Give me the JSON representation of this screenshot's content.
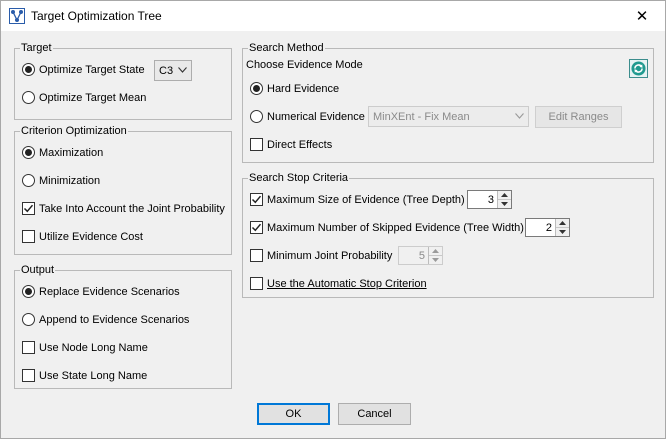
{
  "window": {
    "title": "Target Optimization Tree",
    "close_glyph": "✕"
  },
  "target": {
    "legend": "Target",
    "optimize_state_label": "Optimize Target State",
    "state_value": "C3",
    "optimize_mean_label": "Optimize Target Mean"
  },
  "criterion": {
    "legend": "Criterion Optimization",
    "maximization": "Maximization",
    "minimization": "Minimization",
    "joint_probability": "Take Into Account the Joint Probability",
    "evidence_cost": "Utilize Evidence Cost"
  },
  "output": {
    "legend": "Output",
    "replace": "Replace Evidence Scenarios",
    "append": "Append to Evidence Scenarios",
    "node_long_name": "Use Node Long Name",
    "state_long_name": "Use State Long Name"
  },
  "search_method": {
    "legend": "Search Method",
    "choose_mode": "Choose Evidence Mode",
    "hard_evidence": "Hard Evidence",
    "numerical_evidence": "Numerical Evidence",
    "numerical_method": "MinXEnt - Fix Mean",
    "edit_ranges": "Edit Ranges",
    "direct_effects": "Direct Effects"
  },
  "stop_criteria": {
    "legend": "Search Stop Criteria",
    "max_size": "Maximum Size of Evidence (Tree Depth)",
    "max_size_value": "3",
    "max_skipped": "Maximum Number of Skipped Evidence (Tree Width)",
    "max_skipped_value": "2",
    "min_joint": "Minimum Joint Probability",
    "min_joint_value": "5",
    "automatic": "Use the Automatic Stop Criterion"
  },
  "footer": {
    "ok": "OK",
    "cancel": "Cancel"
  }
}
